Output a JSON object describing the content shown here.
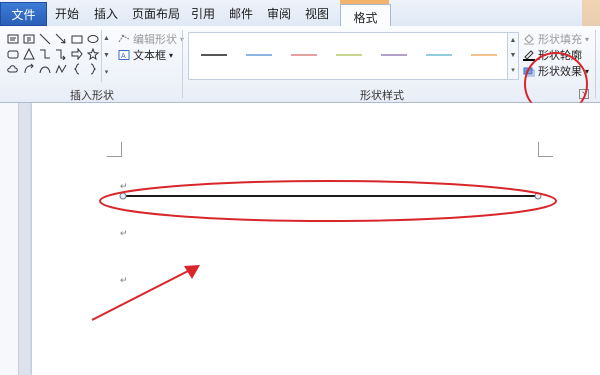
{
  "tabs": {
    "file": "文件",
    "items": [
      "开始",
      "插入",
      "页面布局",
      "引用",
      "邮件",
      "审阅",
      "视图"
    ],
    "active": "格式"
  },
  "ribbon": {
    "insert_shapes": {
      "group_label": "插入形状",
      "edit_shape": "编辑形状",
      "textbox": "文本框",
      "shape_icons": [
        "textbox-icon",
        "vertical-textbox-icon",
        "line-icon",
        "arrow-line-icon",
        "rectangle-icon",
        "oval-icon",
        "rounded-rectangle-icon",
        "triangle-icon",
        "elbow-connector-icon",
        "elbow-arrow-icon",
        "right-arrow-icon",
        "star-icon",
        "cloud-icon",
        "curved-arrow-icon",
        "arc-icon",
        "freeform-icon",
        "left-brace-icon",
        "right-brace-icon"
      ]
    },
    "shape_styles": {
      "group_label": "形状样式",
      "swatch_colors": [
        "#555555",
        "#8eb4e3",
        "#e6a0a0",
        "#c8d890",
        "#b3a2c7",
        "#92cddc",
        "#f2c48d"
      ]
    },
    "shape_fill": "形状填充",
    "shape_outline": "形状轮廓",
    "shape_effects": "形状效果",
    "annotation_color": "#d8262a"
  }
}
